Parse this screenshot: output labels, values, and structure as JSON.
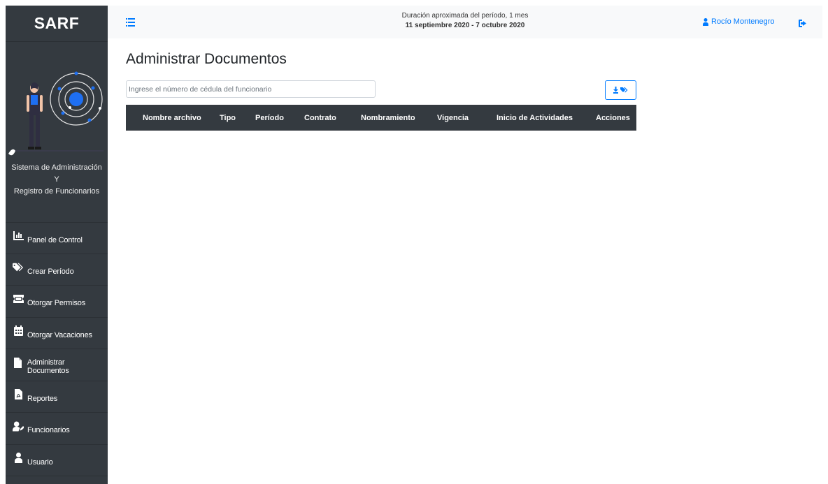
{
  "app": {
    "brand": "SARF"
  },
  "sidebar": {
    "system_name": [
      "Sistema de Administración",
      "Y",
      "Registro de Funcionarios"
    ],
    "items": [
      {
        "label": "Panel de Control",
        "icon": "chart-icon"
      },
      {
        "label": "Crear Período",
        "icon": "tags-icon"
      },
      {
        "label": "Otorgar Permisos",
        "icon": "ticket-icon"
      },
      {
        "label": "Otorgar Vacaciones",
        "icon": "calendar-icon"
      },
      {
        "label": "Administrar Documentos",
        "icon": "file-icon"
      },
      {
        "label": "Reportes",
        "icon": "pdf-file-icon"
      },
      {
        "label": "Funcionarios",
        "icon": "user-edit-icon"
      },
      {
        "label": "Usuario",
        "icon": "user-icon"
      }
    ]
  },
  "topbar": {
    "period_duration": "Duración aproximada del período, 1 mes",
    "period_dates": "11 septiembre 2020 - 7 octubre 2020",
    "user_name": "Rocío Montenegro"
  },
  "main": {
    "title": "Administrar Documentos",
    "search": {
      "placeholder": "Ingrese el número de cédula del funcionario",
      "value": ""
    },
    "table": {
      "columns": [
        "Nombre archivo",
        "Tipo",
        "Período",
        "Contrato",
        "Nombramiento",
        "Vigencia",
        "Inicio de Actividades",
        "Acciones"
      ],
      "rows": []
    }
  },
  "colors": {
    "sidebar_bg": "#343a40",
    "topbar_bg": "#f8f9fa",
    "accent": "#007bff",
    "table_header_bg": "#343a40"
  }
}
